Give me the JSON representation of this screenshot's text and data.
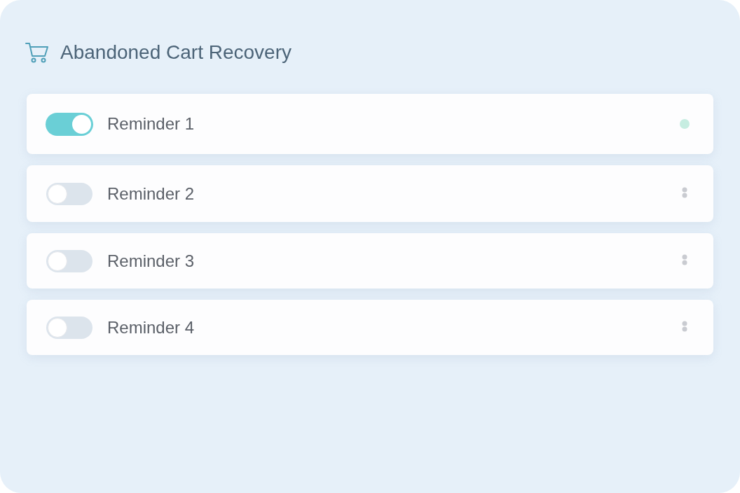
{
  "header": {
    "title": "Abandoned Cart Recovery"
  },
  "reminders": [
    {
      "label": "Reminder 1",
      "on": true,
      "kind": "status",
      "color": "#c6ede1"
    },
    {
      "label": "Reminder 2",
      "on": false,
      "kind": "menu"
    },
    {
      "label": "Reminder 3",
      "on": false,
      "kind": "menu"
    },
    {
      "label": "Reminder 4",
      "on": false,
      "kind": "menu"
    }
  ]
}
